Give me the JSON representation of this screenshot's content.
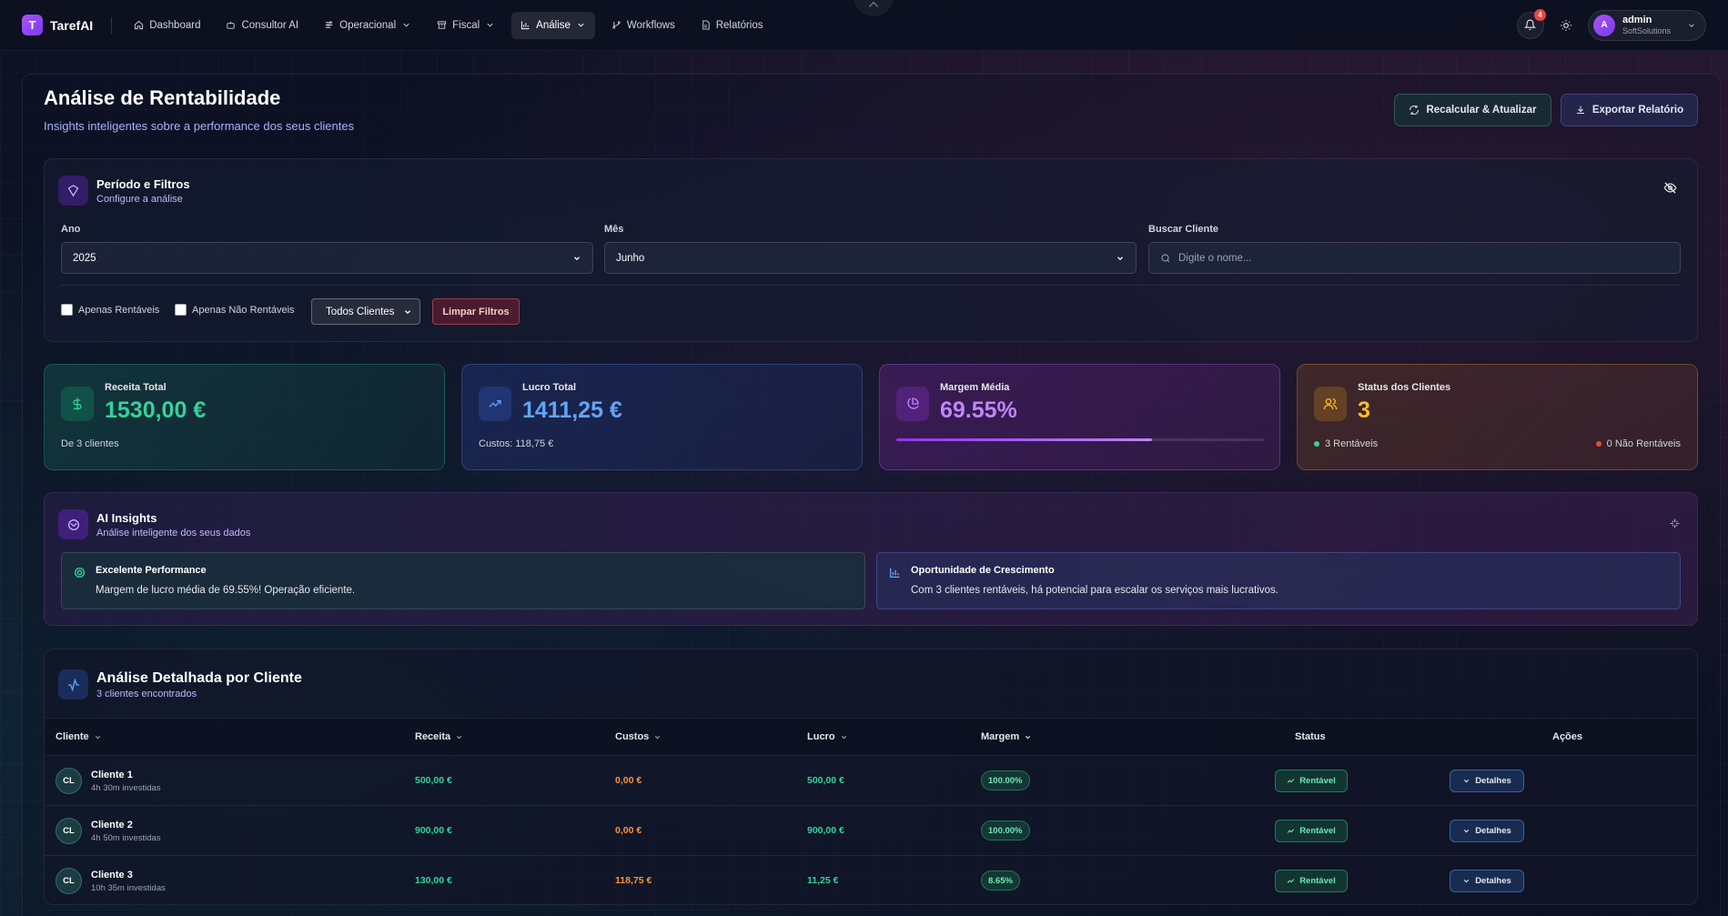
{
  "nav": {
    "brand_initial": "T",
    "brand": "TarefAI",
    "items": [
      {
        "label": "Dashboard",
        "icon": "home-icon"
      },
      {
        "label": "Consultor AI",
        "icon": "bot-icon"
      },
      {
        "label": "Operacional",
        "icon": "sliders-icon"
      },
      {
        "label": "Fiscal",
        "icon": "archive-icon"
      },
      {
        "label": "Análise",
        "icon": "bar-chart-icon"
      },
      {
        "label": "Workflows",
        "icon": "git-branch-icon"
      },
      {
        "label": "Relatórios",
        "icon": "file-icon"
      }
    ],
    "notifications": "4",
    "user": {
      "initial": "A",
      "name": "admin",
      "org": "SoftSolutions"
    }
  },
  "page": {
    "title": "Análise de Rentabilidade",
    "subtitle": "Insights inteligentes sobre a performance dos seus clientes",
    "recalc_label": "Recalcular & Atualizar",
    "export_label": "Exportar Relatório"
  },
  "filters": {
    "title": "Período e Filtros",
    "subtitle": "Configure a análise",
    "year_label": "Ano",
    "year_value": "2025",
    "month_label": "Mês",
    "month_value": "Junho",
    "search_label": "Buscar Cliente",
    "search_placeholder": "Digite o nome...",
    "only_profitable": "Apenas Rentáveis",
    "only_unprofitable": "Apenas Não Rentáveis",
    "clients_select": "Todos Clientes",
    "clear_label": "Limpar Filtros"
  },
  "stats": {
    "revenue": {
      "label": "Receita Total",
      "value": "1530,00 €",
      "note": "De 3 clientes",
      "color": "#34d399"
    },
    "profit": {
      "label": "Lucro Total",
      "value": "1411,25 €",
      "note": "Custos: 118,75 €",
      "color": "#60a5fa"
    },
    "margin": {
      "label": "Margem Média",
      "value": "69.55%",
      "progress": 0.6955,
      "color": "#c084fc"
    },
    "status": {
      "label": "Status dos Clientes",
      "value": "3",
      "profitable": "3 Rentáveis",
      "unprofitable": "0 Não Rentáveis",
      "color": "#fbbf24"
    }
  },
  "ai": {
    "title": "AI Insights",
    "subtitle": "Análise inteligente dos seus dados",
    "insights": [
      {
        "title": "Excelente Performance",
        "text": "Margem de lucro média de 69.55%! Operação eficiente."
      },
      {
        "title": "Oportunidade de Crescimento",
        "text": "Com 3 clientes rentáveis, há potencial para escalar os serviços mais lucrativos."
      }
    ]
  },
  "table": {
    "title": "Análise Detalhada por Cliente",
    "subtitle": "3 clientes encontrados",
    "columns": [
      "Cliente",
      "Receita",
      "Custos",
      "Lucro",
      "Margem",
      "Status",
      "Ações"
    ],
    "rows": [
      {
        "initials": "CL",
        "name": "Cliente 1",
        "time": "4h 30m investidas",
        "revenue": "500,00 €",
        "costs": "0,00 €",
        "profit": "500,00 €",
        "margin": "100.00%",
        "status": "Rentável",
        "action": "Detalhes"
      },
      {
        "initials": "CL",
        "name": "Cliente 2",
        "time": "4h 50m investidas",
        "revenue": "900,00 €",
        "costs": "0,00 €",
        "profit": "900,00 €",
        "margin": "100.00%",
        "status": "Rentável",
        "action": "Detalhes"
      },
      {
        "initials": "CL",
        "name": "Cliente 3",
        "time": "10h 35m investidas",
        "revenue": "130,00 €",
        "costs": "118,75 €",
        "profit": "11,25 €",
        "margin": "8.65%",
        "status": "Rentável",
        "action": "Detalhes"
      }
    ]
  }
}
